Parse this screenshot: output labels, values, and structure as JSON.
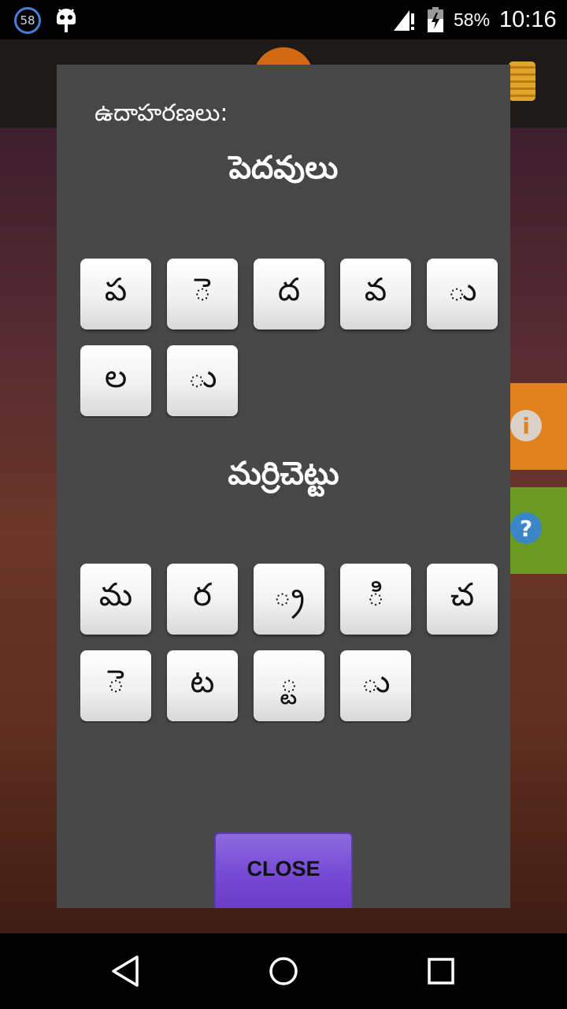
{
  "status_bar": {
    "notification_count": "58",
    "icons": [
      "notification-count-icon",
      "android-debug-icon",
      "signal-icon",
      "battery-charging-icon"
    ],
    "battery_percent": "58%",
    "time": "10:16"
  },
  "dialog": {
    "heading": "ఉదాహరణలు:",
    "examples": [
      {
        "word": "పెదవులు",
        "tiles": [
          "ప",
          "ె",
          "ద",
          "వ",
          "ు",
          "ల",
          "ు"
        ]
      },
      {
        "word": "మర్రిచెట్టు",
        "tiles": [
          "మ",
          "ర",
          "్ర",
          "ి",
          "చ",
          "ె",
          "ట",
          "్ట",
          "ు"
        ]
      }
    ],
    "close_label": "CLOSE"
  },
  "colors": {
    "dialog_bg": "#474747",
    "close_button": "#7448d4",
    "tile_bg": "#f1f1f1"
  },
  "nav_bar": {
    "icons": [
      "back-icon",
      "home-icon",
      "recents-icon"
    ]
  }
}
